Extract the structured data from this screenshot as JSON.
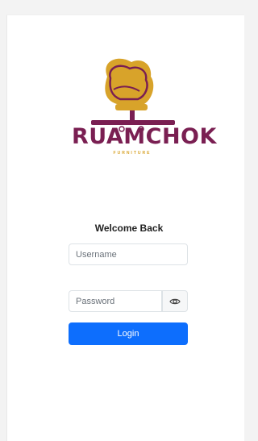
{
  "brand": {
    "name": "RUAMCHOK",
    "tagline": "FURNITURE",
    "colors": {
      "primary": "#7a1f52",
      "accent": "#d8a32a"
    }
  },
  "login": {
    "heading": "Welcome Back",
    "username_placeholder": "Username",
    "password_placeholder": "Password",
    "button_label": "Login",
    "toggle_icon": "eye-icon",
    "button_color": "#0d6efd"
  }
}
